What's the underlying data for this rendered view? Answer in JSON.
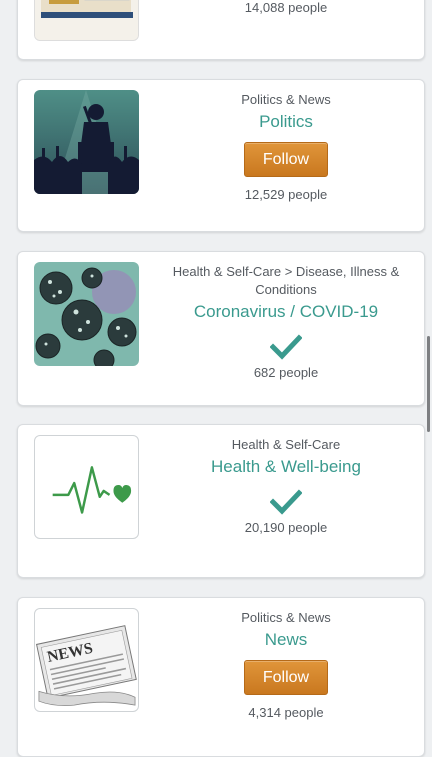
{
  "cards": [
    {
      "category": "",
      "topic": "",
      "following": true,
      "count": "14,088 people",
      "thumb_icon": "book-thumbnail"
    },
    {
      "category": "Politics & News",
      "topic": "Politics",
      "following": false,
      "follow_label": "Follow",
      "count": "12,529 people",
      "thumb_icon": "speaker-podium-thumbnail"
    },
    {
      "category": "Health & Self-Care > Disease, Illness & Conditions",
      "topic": "Coronavirus / COVID-19",
      "following": true,
      "count": "682 people",
      "thumb_icon": "virus-thumbnail"
    },
    {
      "category": "Health & Self-Care",
      "topic": "Health & Well-being",
      "following": true,
      "count": "20,190 people",
      "thumb_icon": "heartbeat-thumbnail"
    },
    {
      "category": "Politics & News",
      "topic": "News",
      "following": false,
      "follow_label": "Follow",
      "count": "4,314 people",
      "thumb_icon": "newspaper-thumbnail"
    }
  ],
  "colors": {
    "accent": "#3a9a8e",
    "follow_button": "#d9882d",
    "background": "#eef0f2"
  }
}
